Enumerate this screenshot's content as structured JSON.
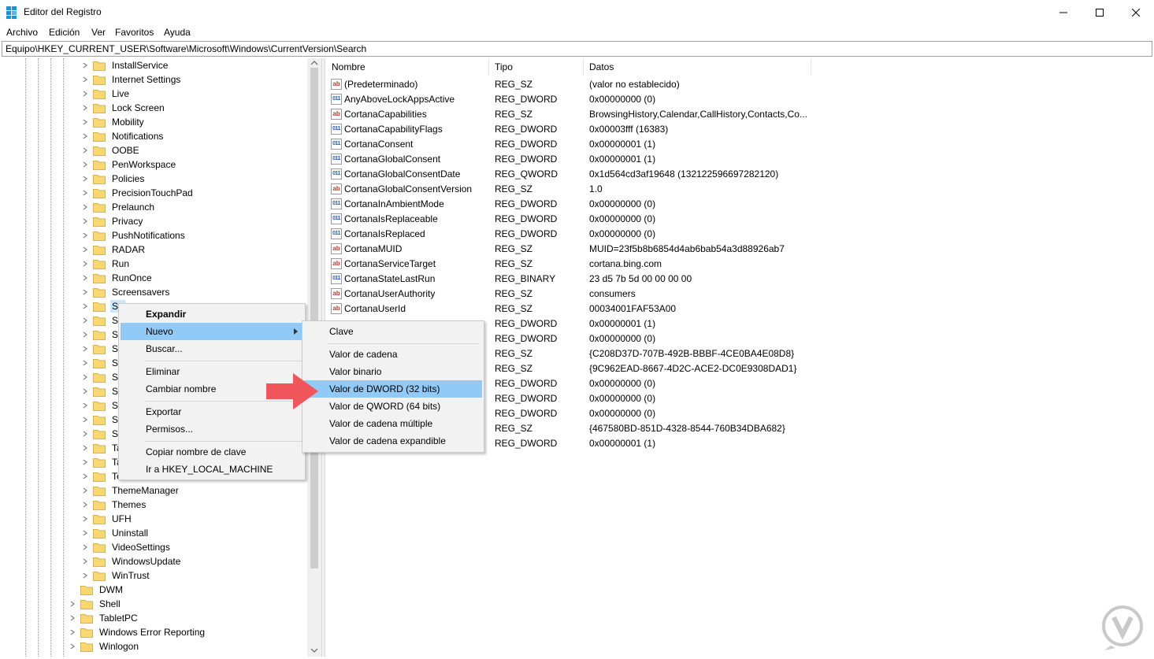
{
  "window": {
    "title": "Editor del Registro"
  },
  "menu": [
    "Archivo",
    "Edición",
    "Ver",
    "Favoritos",
    "Ayuda"
  ],
  "address": "Equipo\\HKEY_CURRENT_USER\\Software\\Microsoft\\Windows\\CurrentVersion\\Search",
  "tree": {
    "children": [
      "InstallService",
      "Internet Settings",
      "Live",
      "Lock Screen",
      "Mobility",
      "Notifications",
      "OOBE",
      "PenWorkspace",
      "Policies",
      "PrecisionTouchPad",
      "Prelaunch",
      "Privacy",
      "PushNotifications",
      "RADAR",
      "Run",
      "RunOnce",
      "Screensavers",
      "Se",
      "Se",
      "Se",
      "Sh",
      "Si",
      "Sr",
      "St",
      "St",
      "St",
      "St",
      "Ta",
      "Ta",
      "Te",
      "ThemeManager",
      "Themes",
      "UFH",
      "Uninstall",
      "VideoSettings",
      "WindowsUpdate",
      "WinTrust"
    ],
    "siblings": [
      "DWM",
      "Shell",
      "TabletPC",
      "Windows Error Reporting",
      "Winlogon"
    ]
  },
  "list": {
    "headers": {
      "name": "Nombre",
      "type": "Tipo",
      "data": "Datos"
    },
    "rows": [
      {
        "icon": "string-value-icon",
        "name": "(Predeterminado)",
        "type": "REG_SZ",
        "data": "(valor no establecido)"
      },
      {
        "icon": "binary-value-icon",
        "name": "AnyAboveLockAppsActive",
        "type": "REG_DWORD",
        "data": "0x00000000 (0)"
      },
      {
        "icon": "string-value-icon",
        "name": "CortanaCapabilities",
        "type": "REG_SZ",
        "data": "BrowsingHistory,Calendar,CallHistory,Contacts,Co..."
      },
      {
        "icon": "binary-value-icon",
        "name": "CortanaCapabilityFlags",
        "type": "REG_DWORD",
        "data": "0x00003fff (16383)"
      },
      {
        "icon": "binary-value-icon",
        "name": "CortanaConsent",
        "type": "REG_DWORD",
        "data": "0x00000001 (1)"
      },
      {
        "icon": "binary-value-icon",
        "name": "CortanaGlobalConsent",
        "type": "REG_DWORD",
        "data": "0x00000001 (1)"
      },
      {
        "icon": "binary-value-icon",
        "name": "CortanaGlobalConsentDate",
        "type": "REG_QWORD",
        "data": "0x1d564cd3af19648 (132122596697282120)"
      },
      {
        "icon": "string-value-icon",
        "name": "CortanaGlobalConsentVersion",
        "type": "REG_SZ",
        "data": "1.0"
      },
      {
        "icon": "binary-value-icon",
        "name": "CortanaInAmbientMode",
        "type": "REG_DWORD",
        "data": "0x00000000 (0)"
      },
      {
        "icon": "binary-value-icon",
        "name": "CortanaIsReplaceable",
        "type": "REG_DWORD",
        "data": "0x00000000 (0)"
      },
      {
        "icon": "binary-value-icon",
        "name": "CortanaIsReplaced",
        "type": "REG_DWORD",
        "data": "0x00000000 (0)"
      },
      {
        "icon": "string-value-icon",
        "name": "CortanaMUID",
        "type": "REG_SZ",
        "data": "MUID=23f5b8b6854d4ab6bab54a3d88926ab7"
      },
      {
        "icon": "string-value-icon",
        "name": "CortanaServiceTarget",
        "type": "REG_SZ",
        "data": "cortana.bing.com"
      },
      {
        "icon": "binary-value-icon",
        "name": "CortanaStateLastRun",
        "type": "REG_BINARY",
        "data": "23 d5 7b 5d 00 00 00 00"
      },
      {
        "icon": "string-value-icon",
        "name": "CortanaUserAuthority",
        "type": "REG_SZ",
        "data": "consumers"
      },
      {
        "icon": "string-value-icon",
        "name": "CortanaUserId",
        "type": "REG_SZ",
        "data": "00034001FAF53A00"
      },
      {
        "icon": "",
        "name": "",
        "type": "REG_DWORD",
        "data": "0x00000001 (1)"
      },
      {
        "icon": "",
        "name": "",
        "type": "REG_DWORD",
        "data": "0x00000000 (0)"
      },
      {
        "icon": "",
        "name": "",
        "type": "REG_SZ",
        "data": "{C208D37D-707B-492B-BBBF-4CE0BA4E08D8}"
      },
      {
        "icon": "",
        "name": "",
        "type": "REG_SZ",
        "data": "{9C962EAD-8667-4D2C-ACE2-DC0E9308DAD1}"
      },
      {
        "icon": "",
        "name": "",
        "type": "REG_DWORD",
        "data": "0x00000000 (0)"
      },
      {
        "icon": "",
        "name": "",
        "type": "REG_DWORD",
        "data": "0x00000000 (0)"
      },
      {
        "icon": "",
        "name": "",
        "type": "REG_DWORD",
        "data": "0x00000000 (0)"
      },
      {
        "icon": "",
        "name": "",
        "type": "REG_SZ",
        "data": "{467580BD-851D-4328-8544-760B34DBA682}"
      },
      {
        "icon": "",
        "name": "",
        "type": "REG_DWORD",
        "data": "0x00000001 (1)"
      }
    ]
  },
  "context_menu": {
    "expand": "Expandir",
    "new": "Nuevo",
    "find": "Buscar...",
    "delete": "Eliminar",
    "rename": "Cambiar nombre",
    "export": "Exportar",
    "permissions": "Permisos...",
    "copy_key_name": "Copiar nombre de clave",
    "goto_hklm": "Ir a HKEY_LOCAL_MACHINE"
  },
  "submenu": {
    "key": "Clave",
    "string": "Valor de cadena",
    "binary": "Valor binario",
    "dword": "Valor de DWORD (32 bits)",
    "qword": "Valor de QWORD (64 bits)",
    "multi_string": "Valor de cadena múltiple",
    "expandable_string": "Valor de cadena expandible"
  },
  "colors": {
    "highlight": "#91c9f7",
    "selection": "#cce8ff",
    "arrow": "#f0555a",
    "folder": "#f8d775"
  }
}
